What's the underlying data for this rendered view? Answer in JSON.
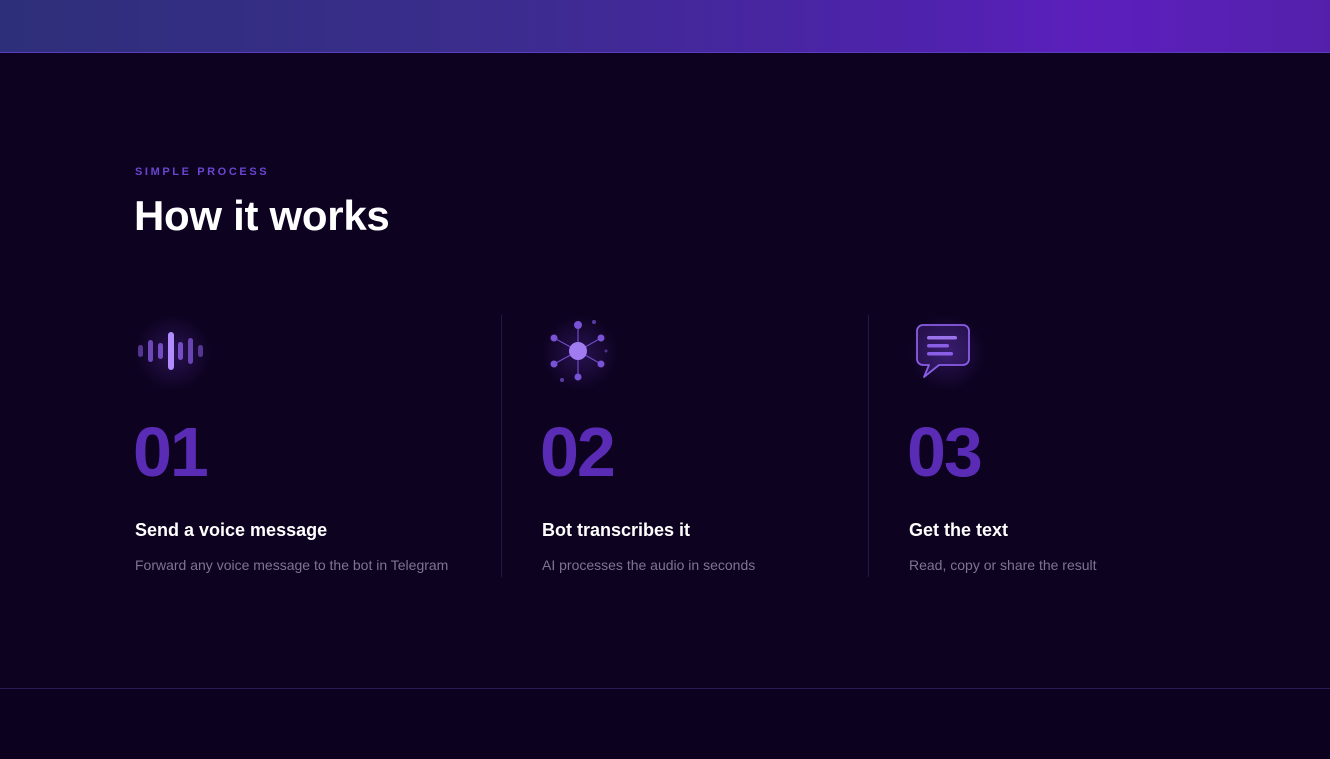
{
  "section": {
    "eyebrow": "SIMPLE PROCESS",
    "heading": "How it works"
  },
  "steps": [
    {
      "number": "01",
      "title": "Send a voice message",
      "description": "Forward any voice message to the bot in Telegram",
      "icon": "soundwave-icon"
    },
    {
      "number": "02",
      "title": "Bot transcribes it",
      "description": "AI processes the audio in seconds",
      "icon": "neural-network-icon"
    },
    {
      "number": "03",
      "title": "Get the text",
      "description": "Read, copy or share the result",
      "icon": "chat-message-icon"
    }
  ],
  "colors": {
    "background": "#0d0220",
    "accent": "#6a45d0",
    "step_number": "#5a2bb4",
    "icon": "#8a5ee6"
  }
}
